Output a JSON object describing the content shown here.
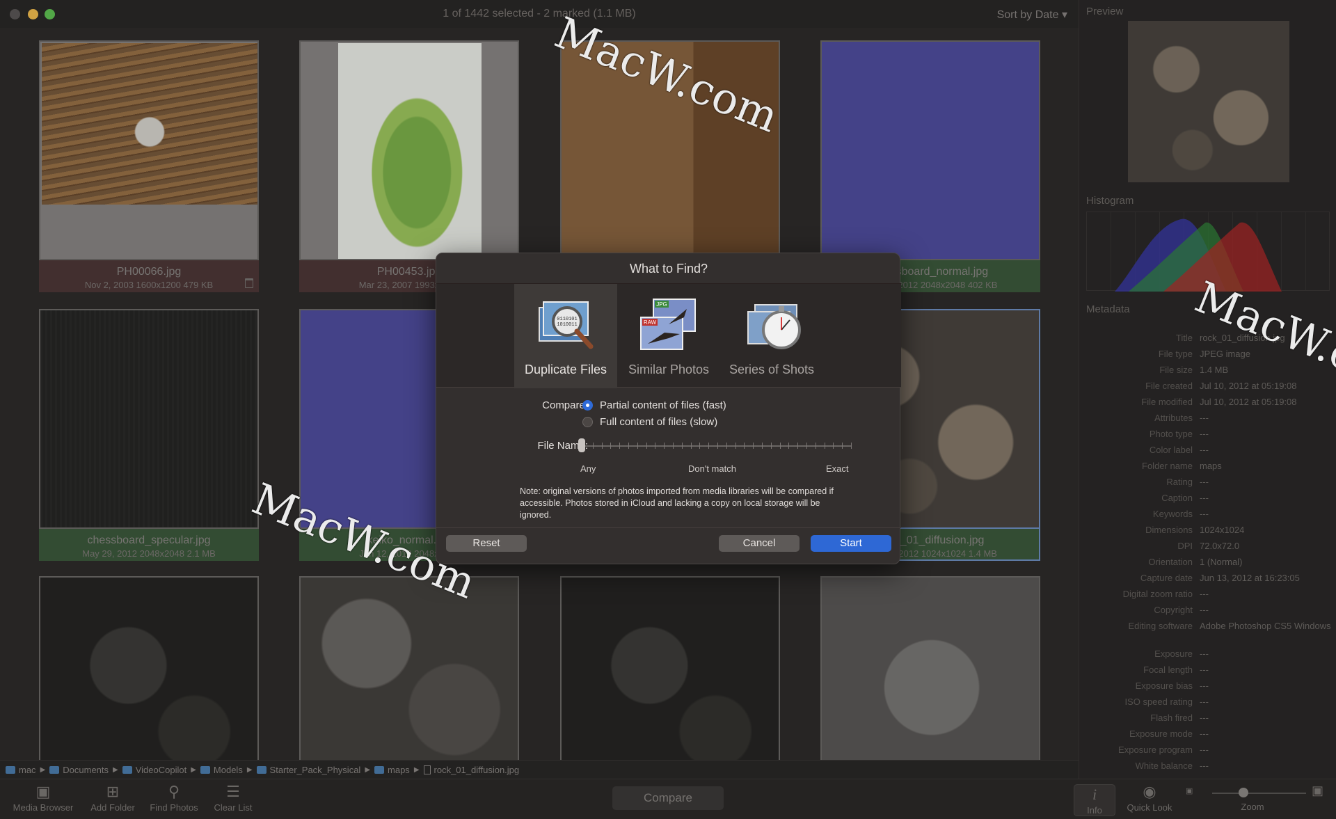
{
  "window": {
    "title": "1 of 1442 selected - 2 marked (1.1 MB)",
    "sort": "Sort by Date ▾"
  },
  "grid": [
    {
      "name": "PH00066.jpg",
      "meta": "Nov 2, 2003  1600x1200  479 KB",
      "state": "del"
    },
    {
      "name": "PH00453.jpg",
      "meta": "Mar 23, 2007  1993x3000",
      "state": "del"
    },
    {
      "name": "",
      "meta": "",
      "state": "normal"
    },
    {
      "name": "chessboard_normal.jpg",
      "meta": "May 29, 2012  2048x2048  402 KB",
      "state": "sel"
    },
    {
      "name": "chessboard_specular.jpg",
      "meta": "May 29, 2012  2048x2048  2.1 MB",
      "state": "sel"
    },
    {
      "name": "keiko_normal.jpg",
      "meta": "Jun 12, 2012  2048x2048",
      "state": "sel"
    },
    {
      "name": "",
      "meta": "",
      "state": "normal"
    },
    {
      "name": "rock_01_diffusion.jpg",
      "meta": "Jun 13, 2012  1024x1024  1.4 MB",
      "state": "active"
    }
  ],
  "breadcrumb": [
    "mac",
    "Documents",
    "VideoCopilot",
    "Models",
    "Starter_Pack_Physical",
    "maps",
    "rock_01_diffusion.jpg"
  ],
  "toolbar": {
    "media_browser": "Media Browser",
    "add_folder": "Add Folder",
    "find_photos": "Find Photos",
    "clear_list": "Clear List",
    "compare": "Compare",
    "info": "Info",
    "quick_look": "Quick Look",
    "zoom": "Zoom"
  },
  "side": {
    "preview": "Preview",
    "histogram": "Histogram",
    "metadata": "Metadata",
    "rows": [
      {
        "k": "Title",
        "v": "rock_01_diffusion.jpg"
      },
      {
        "k": "File type",
        "v": "JPEG image"
      },
      {
        "k": "File size",
        "v": "1.4 MB"
      },
      {
        "k": "File created",
        "v": "Jul 10, 2012 at 05:19:08"
      },
      {
        "k": "File modified",
        "v": "Jul 10, 2012 at 05:19:08"
      },
      {
        "k": "Attributes",
        "v": "---"
      },
      {
        "k": "Photo type",
        "v": "---"
      },
      {
        "k": "Color label",
        "v": "---"
      },
      {
        "k": "Folder name",
        "v": "maps"
      },
      {
        "k": "Rating",
        "v": "---"
      },
      {
        "k": "Caption",
        "v": "---"
      },
      {
        "k": "Keywords",
        "v": "---"
      },
      {
        "k": "Dimensions",
        "v": "1024x1024"
      },
      {
        "k": "DPI",
        "v": "72.0x72.0"
      },
      {
        "k": "Orientation",
        "v": "1 (Normal)"
      },
      {
        "k": "Capture date",
        "v": "Jun 13, 2012 at 16:23:05"
      },
      {
        "k": "Digital zoom ratio",
        "v": "---"
      },
      {
        "k": "Copyright",
        "v": "---"
      },
      {
        "k": "Editing software",
        "v": "Adobe Photoshop CS5 Windows"
      },
      {
        "k": "Exposure",
        "v": "---"
      },
      {
        "k": "Focal length",
        "v": "---"
      },
      {
        "k": "Exposure bias",
        "v": "---"
      },
      {
        "k": "ISO speed rating",
        "v": "---"
      },
      {
        "k": "Flash fired",
        "v": "---"
      },
      {
        "k": "Exposure mode",
        "v": "---"
      },
      {
        "k": "Exposure program",
        "v": "---"
      },
      {
        "k": "White balance",
        "v": "---"
      }
    ]
  },
  "dialog": {
    "title": "What to Find?",
    "tabs": [
      "Duplicate Files",
      "Similar Photos",
      "Series of Shots"
    ],
    "selected_tab": "Duplicate Files",
    "compare_label": "Compare:",
    "compare_options": [
      "Partial content of files (fast)",
      "Full content of files (slow)"
    ],
    "compare_selected": "Partial content of files (fast)",
    "filename_label": "File Name:",
    "slider_labels": [
      "Any",
      "Don't match",
      "Exact"
    ],
    "slider_value": "Any",
    "note": "Note: original versions of photos imported from media libraries will be compared if accessible. Photos stored in iCloud and lacking a copy on local storage will be ignored.",
    "reset": "Reset",
    "cancel": "Cancel",
    "start": "Start",
    "icon_badges": {
      "jpg": "JPG",
      "raw": "RAW"
    }
  },
  "watermark": "MacW.com",
  "colors": {
    "accent": "#2e68d5",
    "selected_caption": "#3c5a3c",
    "marked_caption": "#4e3838"
  }
}
